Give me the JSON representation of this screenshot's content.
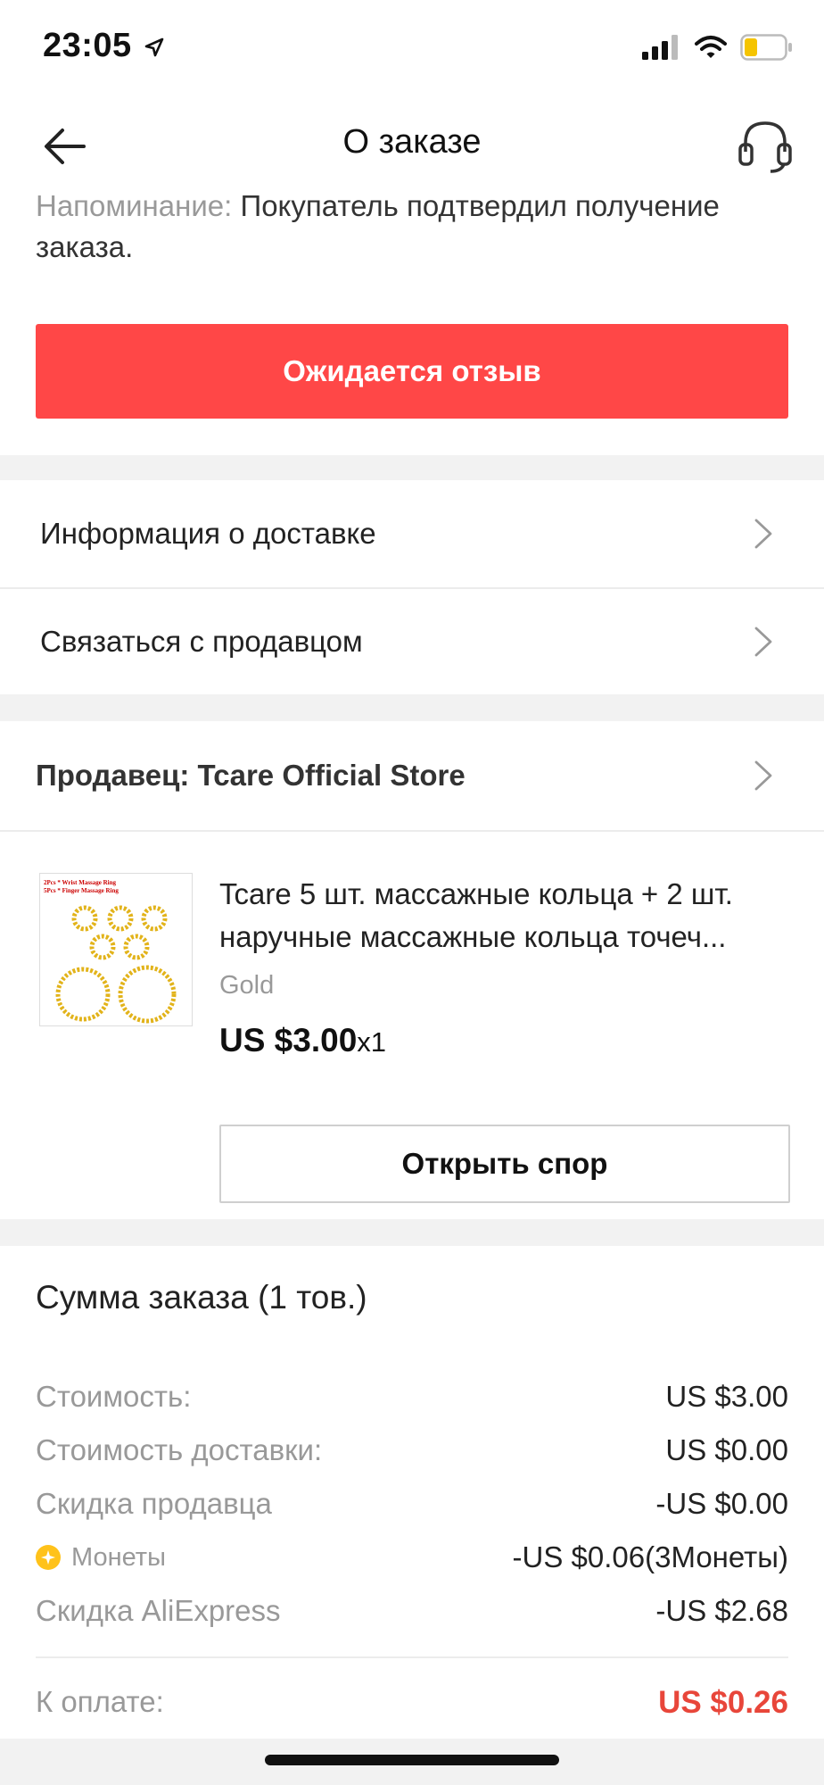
{
  "status": {
    "time": "23:05"
  },
  "header": {
    "title": "О заказе"
  },
  "reminder": {
    "label": "Напоминание:",
    "text": "Покупатель подтвердил получение заказа."
  },
  "primary_action": {
    "label": "Ожидается отзыв"
  },
  "rows": {
    "delivery": "Информация о доставке",
    "contact": "Связаться с продавцом"
  },
  "seller": {
    "label": "Продавец: Tcare Official Store"
  },
  "product": {
    "title": "Tcare 5 шт. массажные кольца + 2 шт. наручные массажные кольца точеч...",
    "variant": "Gold",
    "price": "US $3.00",
    "qty": "x1",
    "thumb_lines": [
      "2Pcs * Wrist Massage Ring",
      "5Pcs * Finger Massage Ring"
    ],
    "dispute_label": "Открыть спор"
  },
  "summary": {
    "title": "Сумма заказа (1 тов.)",
    "rows": [
      {
        "label": "Стоимость:",
        "value": "US $3.00"
      },
      {
        "label": "Стоимость доставки:",
        "value": "US $0.00"
      },
      {
        "label": "Скидка продавца",
        "value": "-US $0.00"
      },
      {
        "label": "Монеты",
        "value": "-US $0.06(3Монеты)"
      },
      {
        "label": "Скидка AliExpress",
        "value": "-US $2.68"
      }
    ],
    "total_label": "К оплате:",
    "total_value": "US $0.26"
  },
  "colors": {
    "accent": "#ff4747",
    "total": "#e8463a",
    "coin": "#ffc21a",
    "battery": "#f5c400"
  }
}
